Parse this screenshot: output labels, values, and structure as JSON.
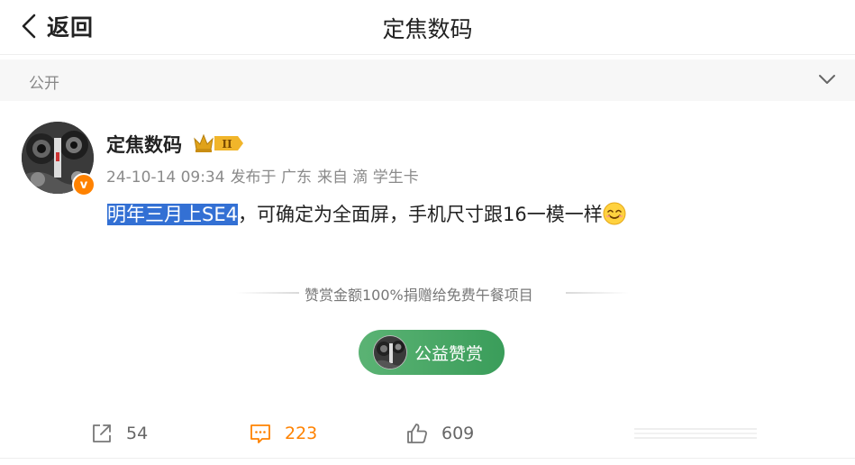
{
  "header": {
    "back_label": "返回",
    "title": "定焦数码"
  },
  "visibility": {
    "label": "公开"
  },
  "post": {
    "username": "定焦数码",
    "crown_level": "II",
    "verified_badge": "v",
    "meta": {
      "timestamp": "24-10-14 09:34",
      "location": "发布于 广东",
      "source": "来自 滴 学生卡"
    },
    "text_highlighted": "明年三月上SE4",
    "text_rest": "，可确定为全面屏，手机尺寸跟16一模一样",
    "emoji": "smile-emoji"
  },
  "reward": {
    "note": "赞赏金额100%捐赠给免费午餐项目",
    "button_label": "公益赞赏"
  },
  "actions": {
    "share_count": "54",
    "comment_count": "223",
    "like_count": "609"
  },
  "colors": {
    "accent_orange": "#ff8200",
    "highlight_blue": "#3370d4",
    "reward_green": "#4caf68",
    "crown_gold": "#e0a21a"
  }
}
